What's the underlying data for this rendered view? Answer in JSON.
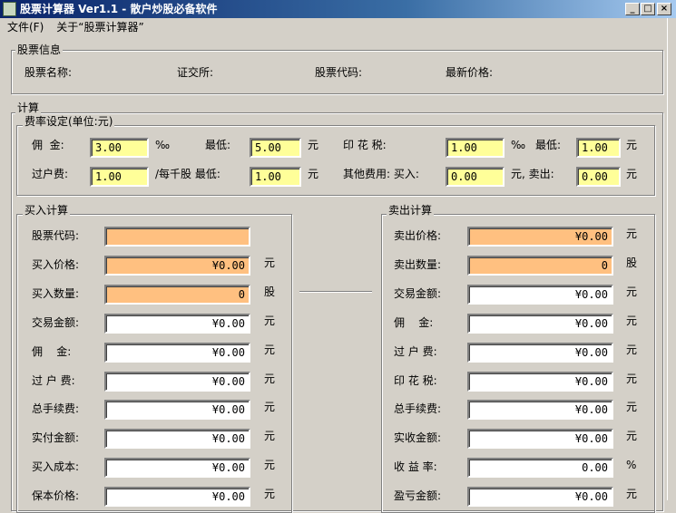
{
  "window": {
    "title": "股票计算器 Ver1.1 - 散户炒股必备软件",
    "min": "_",
    "max": "□",
    "close": "×"
  },
  "menu": [
    "文件(F)",
    "关于“股票计算器”"
  ],
  "info": {
    "group": "股票信息",
    "name": "股票名称:",
    "exchange": "证交所:",
    "code": "股票代码:",
    "price": "最新价格:"
  },
  "calc": {
    "group": "计算"
  },
  "fees": {
    "group": "费率设定(单位:元)",
    "commission_label": "佣  金:",
    "commission": "3.00",
    "permille": "‰",
    "min_label": "最低:",
    "commission_min": "5.00",
    "yuan": "元",
    "stamp_label": "印 花 税:",
    "stamp": "1.00",
    "stamp_min": "1.00",
    "transfer_label": "过户费:",
    "transfer": "1.00",
    "per_thousand": "/每千股 最低:",
    "transfer_min": "1.00",
    "other_label": "其他费用: 买入:",
    "other_buy": "0.00",
    "sell_label": "元, 卖出:",
    "other_sell": "0.00"
  },
  "buy": {
    "group": "买入计算",
    "rows": [
      {
        "label": "股票代码:",
        "value": "",
        "unit": "",
        "style": "o"
      },
      {
        "label": "买入价格:",
        "value": "¥0.00",
        "unit": "元",
        "style": "o"
      },
      {
        "label": "买入数量:",
        "value": "0",
        "unit": "股",
        "style": "o"
      },
      {
        "label": "交易金额:",
        "value": "¥0.00",
        "unit": "元",
        "style": "w"
      },
      {
        "label": "佣    金:",
        "value": "¥0.00",
        "unit": "元",
        "style": "w"
      },
      {
        "label": "过 户 费:",
        "value": "¥0.00",
        "unit": "元",
        "style": "w"
      },
      {
        "label": "总手续费:",
        "value": "¥0.00",
        "unit": "元",
        "style": "w"
      },
      {
        "label": "实付金额:",
        "value": "¥0.00",
        "unit": "元",
        "style": "w"
      },
      {
        "label": "买入成本:",
        "value": "¥0.00",
        "unit": "元",
        "style": "w"
      },
      {
        "label": "保本价格:",
        "value": "¥0.00",
        "unit": "元",
        "style": "w"
      }
    ]
  },
  "sell": {
    "group": "卖出计算",
    "rows": [
      {
        "label": "卖出价格:",
        "value": "¥0.00",
        "unit": "元",
        "style": "o"
      },
      {
        "label": "卖出数量:",
        "value": "0",
        "unit": "股",
        "style": "o"
      },
      {
        "label": "交易金额:",
        "value": "¥0.00",
        "unit": "元",
        "style": "w"
      },
      {
        "label": "佣    金:",
        "value": "¥0.00",
        "unit": "元",
        "style": "w"
      },
      {
        "label": "过 户 费:",
        "value": "¥0.00",
        "unit": "元",
        "style": "w"
      },
      {
        "label": "印 花 税:",
        "value": "¥0.00",
        "unit": "元",
        "style": "w"
      },
      {
        "label": "总手续费:",
        "value": "¥0.00",
        "unit": "元",
        "style": "w"
      },
      {
        "label": "实收金额:",
        "value": "¥0.00",
        "unit": "元",
        "style": "w"
      },
      {
        "label": "收 益 率:",
        "value": "0.00",
        "unit": "%",
        "style": "w"
      },
      {
        "label": "盈亏金额:",
        "value": "¥0.00",
        "unit": "元",
        "style": "w"
      }
    ]
  }
}
